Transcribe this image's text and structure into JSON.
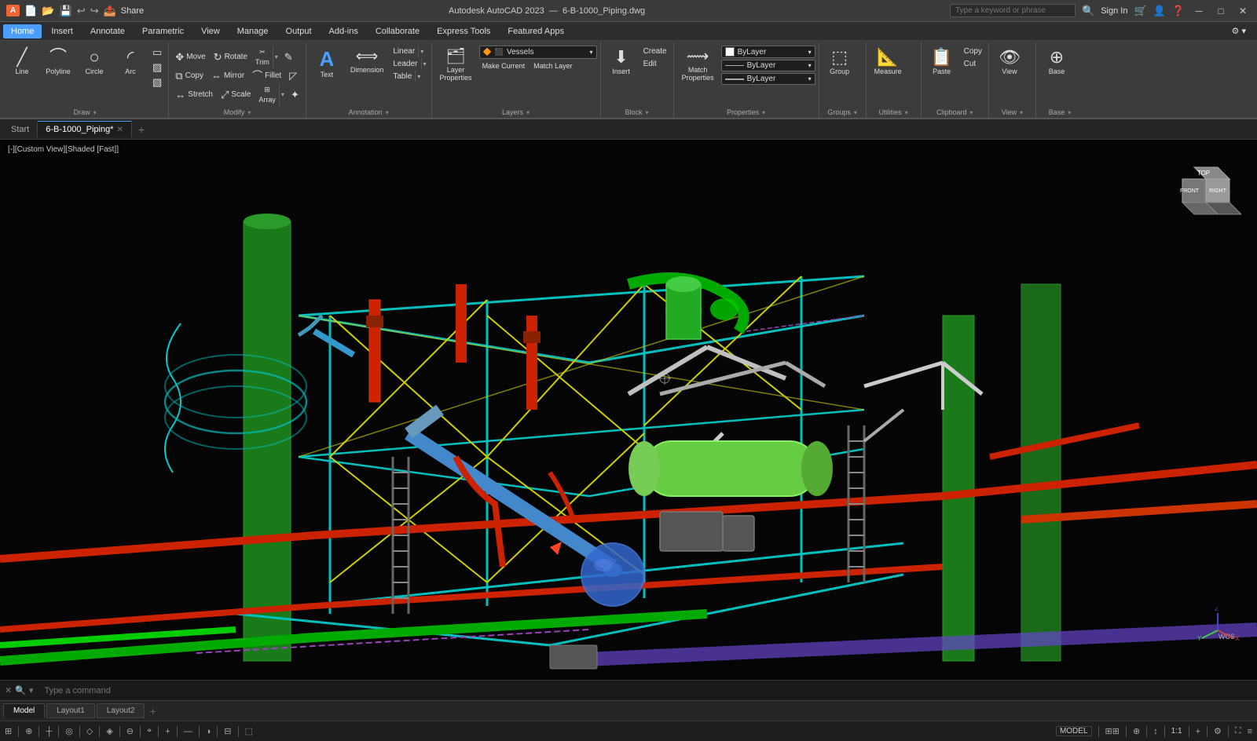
{
  "app": {
    "logo": "A",
    "title": "Autodesk AutoCAD 2023",
    "filename": "6-B-1000_Piping.dwg",
    "search_placeholder": "Type a keyword or phrase"
  },
  "titlebar": {
    "share_btn": "Share",
    "sign_in": "Sign In",
    "minimize": "─",
    "maximize": "□",
    "close": "✕"
  },
  "menu": {
    "items": [
      "Home",
      "Insert",
      "Annotate",
      "Parametric",
      "View",
      "Manage",
      "Output",
      "Add-ins",
      "Collaborate",
      "Express Tools",
      "Featured Apps"
    ]
  },
  "ribbon": {
    "groups": [
      {
        "name": "draw",
        "label": "Draw",
        "buttons": [
          {
            "id": "line",
            "icon": "╱",
            "label": "Line",
            "large": true
          },
          {
            "id": "polyline",
            "icon": "⌒",
            "label": "Polyline",
            "large": true
          },
          {
            "id": "circle",
            "icon": "○",
            "label": "Circle",
            "large": true
          },
          {
            "id": "arc",
            "icon": "◜",
            "label": "Arc",
            "large": true
          }
        ]
      },
      {
        "name": "modify",
        "label": "Modify",
        "buttons": [
          {
            "id": "move",
            "icon": "✥",
            "label": "Move",
            "small": true
          },
          {
            "id": "rotate",
            "icon": "↻",
            "label": "Rotate",
            "small": true
          },
          {
            "id": "trim",
            "icon": "✂",
            "label": "Trim",
            "small": true
          },
          {
            "id": "copy",
            "icon": "⧉",
            "label": "Copy",
            "small": true
          },
          {
            "id": "mirror",
            "icon": "⇔",
            "label": "Mirror",
            "small": true
          },
          {
            "id": "fillet",
            "icon": "⌒",
            "label": "Fillet",
            "small": true
          },
          {
            "id": "stretch",
            "icon": "↔",
            "label": "Stretch",
            "small": true
          },
          {
            "id": "scale",
            "icon": "⤢",
            "label": "Scale",
            "small": true
          },
          {
            "id": "array",
            "icon": "⊞",
            "label": "Array",
            "small": true
          }
        ]
      },
      {
        "name": "annotation",
        "label": "Annotation",
        "buttons": [
          {
            "id": "text",
            "icon": "A",
            "label": "Text",
            "large": true
          },
          {
            "id": "dimension",
            "icon": "⟺",
            "label": "Dimension",
            "large": true
          },
          {
            "id": "linear",
            "icon": "←→",
            "label": "Linear"
          },
          {
            "id": "leader",
            "icon": "↗",
            "label": "Leader"
          },
          {
            "id": "table",
            "icon": "⊞",
            "label": "Table"
          }
        ]
      },
      {
        "name": "layers",
        "label": "Layers",
        "layer_name": "Vessels",
        "buttons": [
          {
            "id": "layer-props",
            "icon": "≡",
            "label": "Layer Properties",
            "large": true
          },
          {
            "id": "make-current",
            "icon": "✓",
            "label": "Make Current",
            "small": true
          },
          {
            "id": "match-layer",
            "icon": "⟿",
            "label": "Match Layer",
            "small": true
          }
        ]
      },
      {
        "name": "block",
        "label": "Block",
        "buttons": [
          {
            "id": "insert",
            "icon": "↓",
            "label": "Insert",
            "large": true
          },
          {
            "id": "create",
            "icon": "+",
            "label": "Create",
            "small": true
          },
          {
            "id": "edit",
            "icon": "✎",
            "label": "Edit",
            "small": true
          }
        ]
      },
      {
        "name": "properties",
        "label": "Properties",
        "buttons": [
          {
            "id": "match-props",
            "icon": "⟿",
            "label": "Match Properties",
            "large": true
          }
        ],
        "dropdowns": [
          {
            "label": "ByLayer",
            "type": "color"
          },
          {
            "label": "ByLayer",
            "type": "linetype"
          },
          {
            "label": "ByLayer",
            "type": "lineweight"
          }
        ]
      },
      {
        "name": "groups",
        "label": "Groups",
        "buttons": [
          {
            "id": "group",
            "icon": "⬚",
            "label": "Group",
            "large": true
          }
        ]
      },
      {
        "name": "utilities",
        "label": "Utilities",
        "buttons": [
          {
            "id": "measure",
            "icon": "📐",
            "label": "Measure",
            "large": true
          }
        ]
      },
      {
        "name": "clipboard",
        "label": "Clipboard",
        "buttons": [
          {
            "id": "paste",
            "icon": "📋",
            "label": "Paste",
            "large": true
          },
          {
            "id": "copy-clip",
            "icon": "⧉",
            "label": "Copy",
            "small": true
          }
        ]
      },
      {
        "name": "view",
        "label": "View",
        "buttons": [
          {
            "id": "view-btn",
            "icon": "👁",
            "label": "View",
            "large": true
          }
        ]
      },
      {
        "name": "base",
        "label": "Base",
        "buttons": [
          {
            "id": "base-btn",
            "icon": "⊕",
            "label": "Base",
            "large": true
          }
        ]
      }
    ]
  },
  "tabs": [
    {
      "id": "start",
      "label": "Start",
      "closable": false
    },
    {
      "id": "drawing",
      "label": "6-B-1000_Piping*",
      "closable": true,
      "active": true
    }
  ],
  "viewport": {
    "label": "[-][Custom View][Shaded [Fast]]"
  },
  "status": {
    "model": "MODEL",
    "scale": "1:1",
    "cmd_placeholder": "Type a command",
    "zoom": "1:1"
  },
  "layout_tabs": [
    {
      "id": "model",
      "label": "Model",
      "active": true
    },
    {
      "id": "layout1",
      "label": "Layout1"
    },
    {
      "id": "layout2",
      "label": "Layout2"
    }
  ],
  "viewcube": {
    "faces": [
      "FRONT",
      "RIGHT",
      "TOP"
    ],
    "label": "WCS"
  }
}
